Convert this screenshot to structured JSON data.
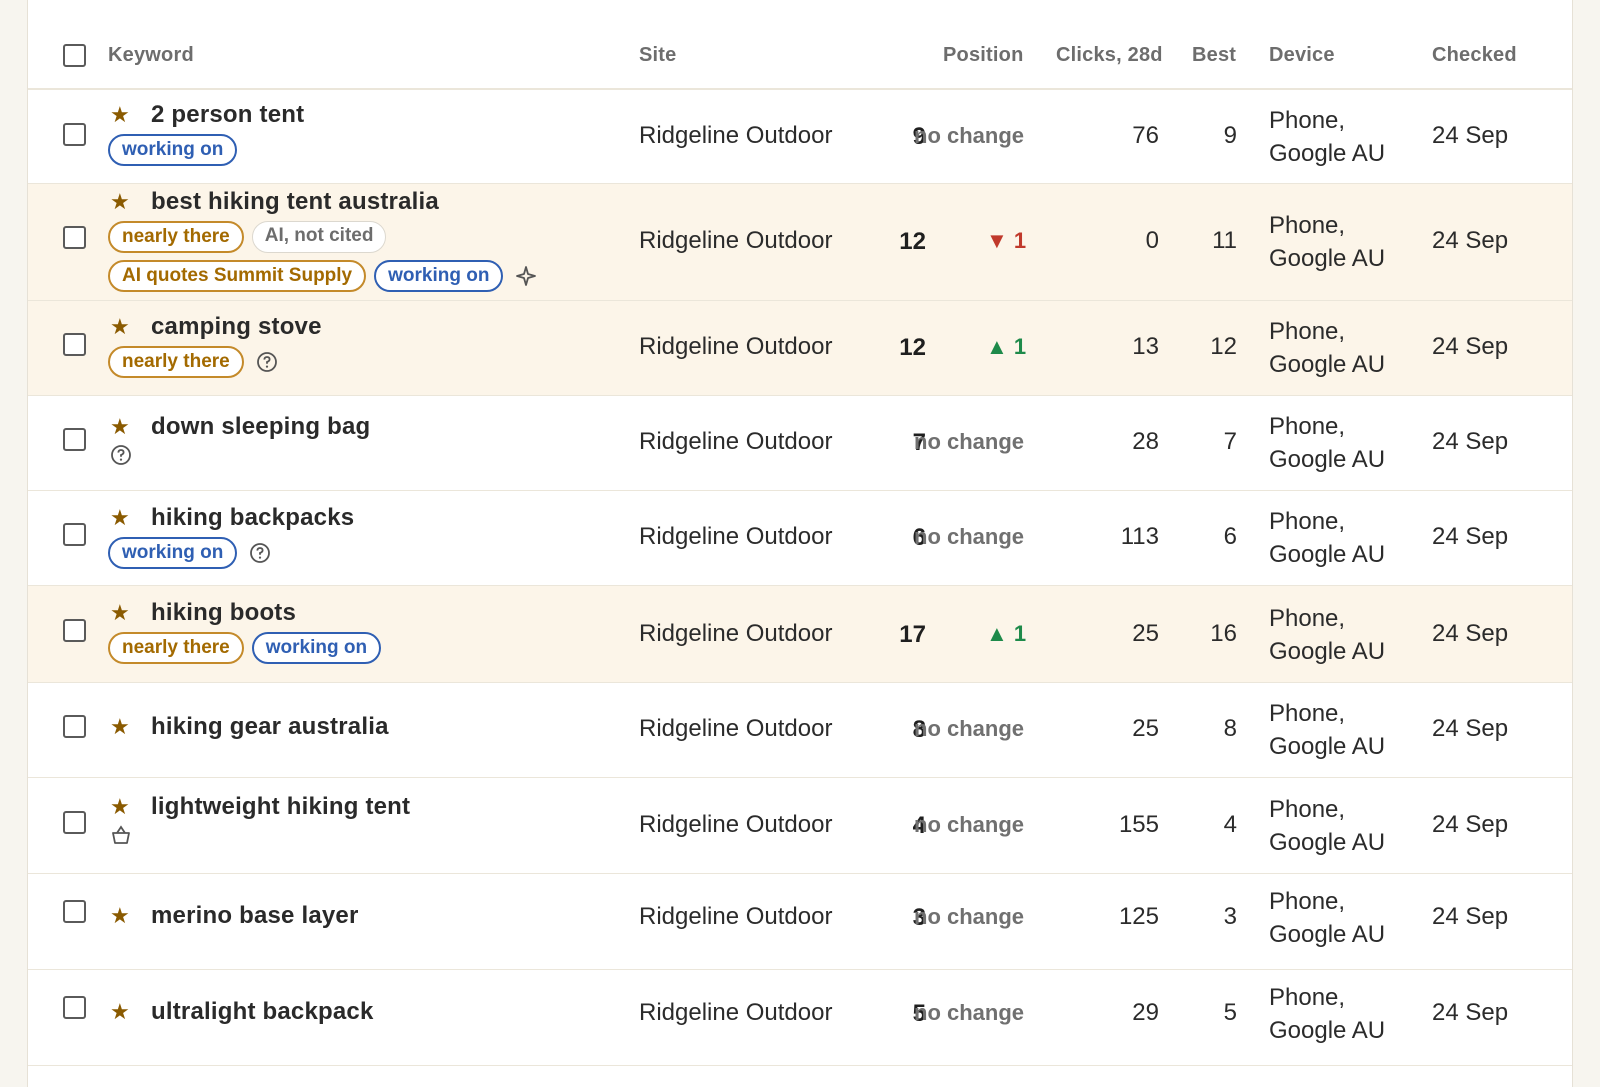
{
  "header": {
    "keyword": "Keyword",
    "site": "Site",
    "position": "Position",
    "clicks": "Clicks, 28d",
    "best": "Best",
    "device": "Device",
    "checked": "Checked"
  },
  "icons": {
    "star": "star-icon",
    "help": "help-circle-icon",
    "sparkle": "sparkle-icon",
    "basket": "basket-icon"
  },
  "colors": {
    "accent_star": "#8a5a00",
    "tag_working": "#2f5fb3",
    "tag_nearly": "#a36a00",
    "change_up": "#1e8a4a",
    "change_down": "#c0392b",
    "row_highlight": "#fcf5e9"
  },
  "rows": [
    {
      "keyword": "2 person tent",
      "site": "Ridgeline Outdoor",
      "position": "9",
      "change": "no change",
      "clicks": "76",
      "best": "9",
      "device_line1": "Phone,",
      "device_line2": "Google AU",
      "checked": "24 Sep",
      "tags": [
        "working on"
      ]
    },
    {
      "keyword": "best hiking tent australia",
      "site": "Ridgeline Outdoor",
      "position": "12",
      "change": "1",
      "change_dir": "down",
      "clicks": "0",
      "best": "11",
      "device_line1": "Phone,",
      "device_line2": "Google AU",
      "checked": "24 Sep",
      "tags": [
        "nearly there",
        "AI, not cited",
        "AI quotes Summit Supply",
        "working on"
      ]
    },
    {
      "keyword": "camping stove",
      "site": "Ridgeline Outdoor",
      "position": "12",
      "change": "1",
      "change_dir": "up",
      "clicks": "13",
      "best": "12",
      "device_line1": "Phone,",
      "device_line2": "Google AU",
      "checked": "24 Sep",
      "tags": [
        "nearly there"
      ]
    },
    {
      "keyword": "down sleeping bag",
      "site": "Ridgeline Outdoor",
      "position": "7",
      "change": "no change",
      "clicks": "28",
      "best": "7",
      "device_line1": "Phone,",
      "device_line2": "Google AU",
      "checked": "24 Sep",
      "tags": []
    },
    {
      "keyword": "hiking backpacks",
      "site": "Ridgeline Outdoor",
      "position": "6",
      "change": "no change",
      "clicks": "113",
      "best": "6",
      "device_line1": "Phone,",
      "device_line2": "Google AU",
      "checked": "24 Sep",
      "tags": [
        "working on"
      ]
    },
    {
      "keyword": "hiking boots",
      "site": "Ridgeline Outdoor",
      "position": "17",
      "change": "1",
      "change_dir": "up",
      "clicks": "25",
      "best": "16",
      "device_line1": "Phone,",
      "device_line2": "Google AU",
      "checked": "24 Sep",
      "tags": [
        "nearly there",
        "working on"
      ]
    },
    {
      "keyword": "hiking gear australia",
      "site": "Ridgeline Outdoor",
      "position": "8",
      "change": "no change",
      "clicks": "25",
      "best": "8",
      "device_line1": "Phone,",
      "device_line2": "Google AU",
      "checked": "24 Sep",
      "tags": []
    },
    {
      "keyword": "lightweight hiking tent",
      "site": "Ridgeline Outdoor",
      "position": "4",
      "change": "no change",
      "clicks": "155",
      "best": "4",
      "device_line1": "Phone,",
      "device_line2": "Google AU",
      "checked": "24 Sep",
      "tags": []
    },
    {
      "keyword": "merino base layer",
      "site": "Ridgeline Outdoor",
      "position": "3",
      "change": "no change",
      "clicks": "125",
      "best": "3",
      "device_line1": "Phone,",
      "device_line2": "Google AU",
      "checked": "24 Sep",
      "tags": []
    },
    {
      "keyword": "ultralight backpack",
      "site": "Ridgeline Outdoor",
      "position": "5",
      "change": "no change",
      "clicks": "29",
      "best": "5",
      "device_line1": "Phone,",
      "device_line2": "Google AU",
      "checked": "24 Sep",
      "tags": []
    }
  ]
}
